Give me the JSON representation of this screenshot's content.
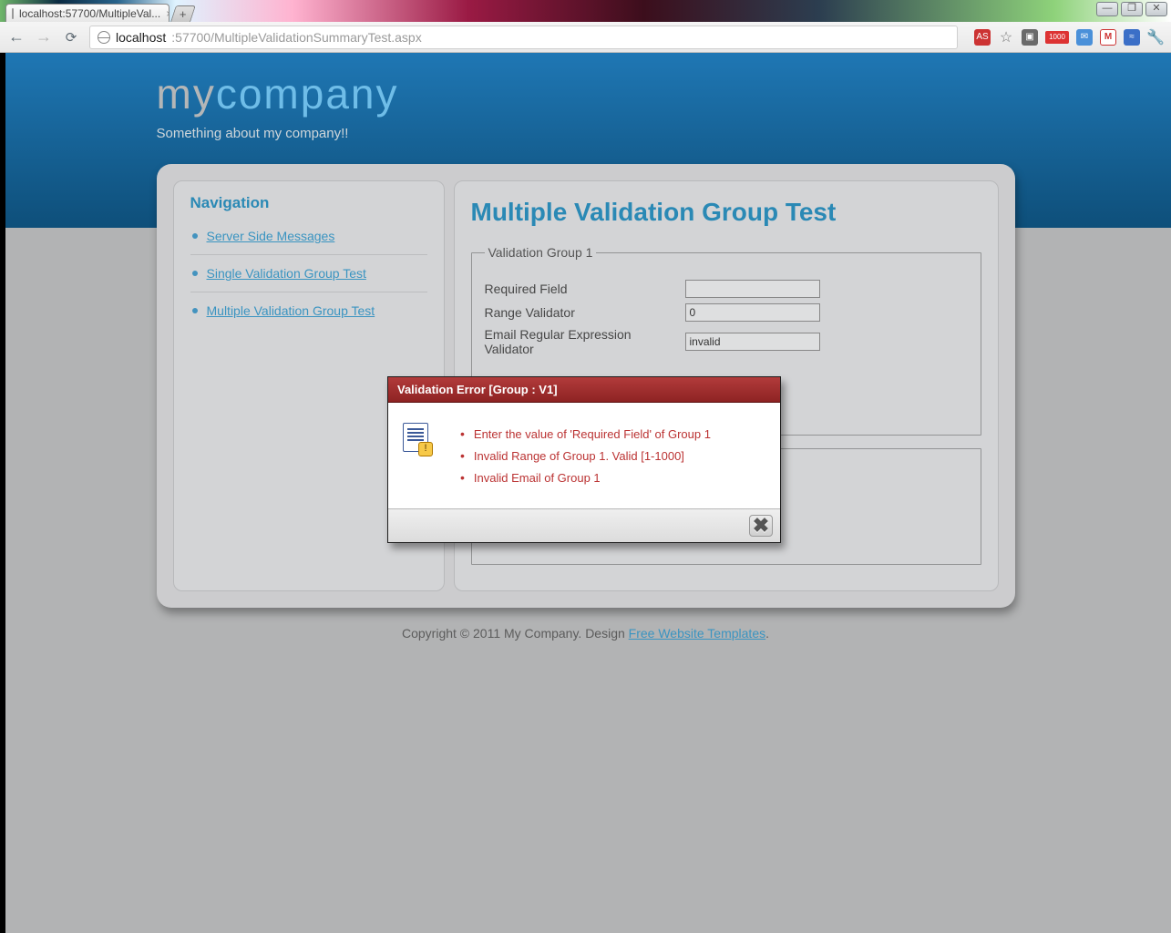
{
  "browser": {
    "tab_title": "localhost:57700/MultipleVal...",
    "url_host": "localhost",
    "url_rest": ":57700/MultipleValidationSummaryTest.aspx",
    "ext_as": "AS",
    "ext_n1000": "1000",
    "ext_gmail_letter": "M"
  },
  "site": {
    "logo_first": "my",
    "logo_second": "company",
    "tagline": "Something about my company!!"
  },
  "nav": {
    "title": "Navigation",
    "items": [
      {
        "label": "Server Side Messages"
      },
      {
        "label": "Single Validation Group Test"
      },
      {
        "label": "Multiple Validation Group Test"
      }
    ]
  },
  "page": {
    "title": "Multiple Validation Group Test"
  },
  "group1": {
    "legend": "Validation Group 1",
    "field_required_label": "Required Field",
    "field_required_value": "",
    "field_range_label": "Range Validator",
    "field_range_value": "0",
    "field_email_label": "Email Regular Expression Validator",
    "field_email_value": "invalid"
  },
  "group2": {
    "legend": ""
  },
  "dialog": {
    "title": "Validation Error [Group : V1]",
    "errors": [
      "Enter the value of 'Required Field' of Group 1",
      "Invalid Range of Group 1. Valid [1-1000]",
      "Invalid Email of Group 1"
    ]
  },
  "footer": {
    "text_before": "Copyright © 2011 My Company. Design ",
    "link": "Free Website Templates",
    "text_after": "."
  }
}
